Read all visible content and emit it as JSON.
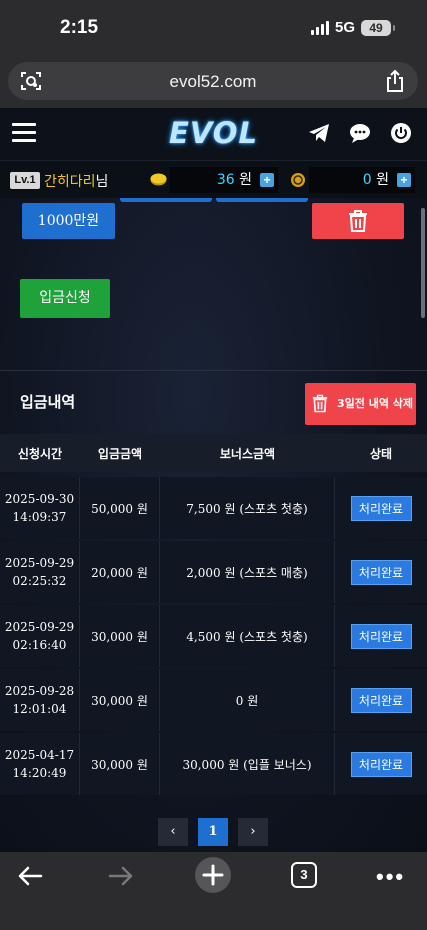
{
  "status_bar": {
    "time": "2:15",
    "network": "5G",
    "battery": "49"
  },
  "browser": {
    "url": "evol52.com",
    "tab_count": "3"
  },
  "site": {
    "logo": "EVOL",
    "user": {
      "level": "Lv.1",
      "name": "간히다리",
      "suffix": "님"
    },
    "balance": {
      "cash": "36",
      "cash_unit": "원",
      "points": "0",
      "points_unit": "원"
    }
  },
  "deposit_form": {
    "amount_button": "1000만원",
    "submit_label": "입금신청"
  },
  "history": {
    "title": "입금내역",
    "delete_old_label": "3일전 내역 삭제",
    "columns": [
      "신청시간",
      "입금금액",
      "보너스금액",
      "상태"
    ],
    "rows": [
      {
        "date": "2025-09-30",
        "time": "14:09:37",
        "amount": "50,000 원",
        "bonus": "7,500 원 (스포츠 첫충)",
        "status": "처리완료"
      },
      {
        "date": "2025-09-29",
        "time": "02:25:32",
        "amount": "20,000 원",
        "bonus": "2,000 원 (스포츠 매충)",
        "status": "처리완료"
      },
      {
        "date": "2025-09-29",
        "time": "02:16:40",
        "amount": "30,000 원",
        "bonus": "4,500 원 (스포츠 첫충)",
        "status": "처리완료"
      },
      {
        "date": "2025-09-28",
        "time": "12:01:04",
        "amount": "30,000 원",
        "bonus": "0 원",
        "status": "처리완료"
      },
      {
        "date": "2025-04-17",
        "time": "14:20:49",
        "amount": "30,000 원",
        "bonus": "30,000 원 (입플 보너스)",
        "status": "처리완료"
      }
    ],
    "pagination": {
      "prev": "‹",
      "current": "1",
      "next": "›"
    }
  },
  "colors": {
    "accent_blue": "#1f6fd1",
    "danger_red": "#f0444b",
    "success_green": "#20a23a",
    "gold": "#f5c518",
    "cyan": "#3fd6ff"
  },
  "icons": [
    "camera-lens-icon",
    "share-icon",
    "hamburger-icon",
    "telegram-icon",
    "chat-icon",
    "power-icon",
    "coin-icon",
    "chip-icon",
    "trash-icon",
    "back-arrow-icon",
    "forward-arrow-icon",
    "new-tab-icon",
    "tabs-icon",
    "more-icon"
  ]
}
